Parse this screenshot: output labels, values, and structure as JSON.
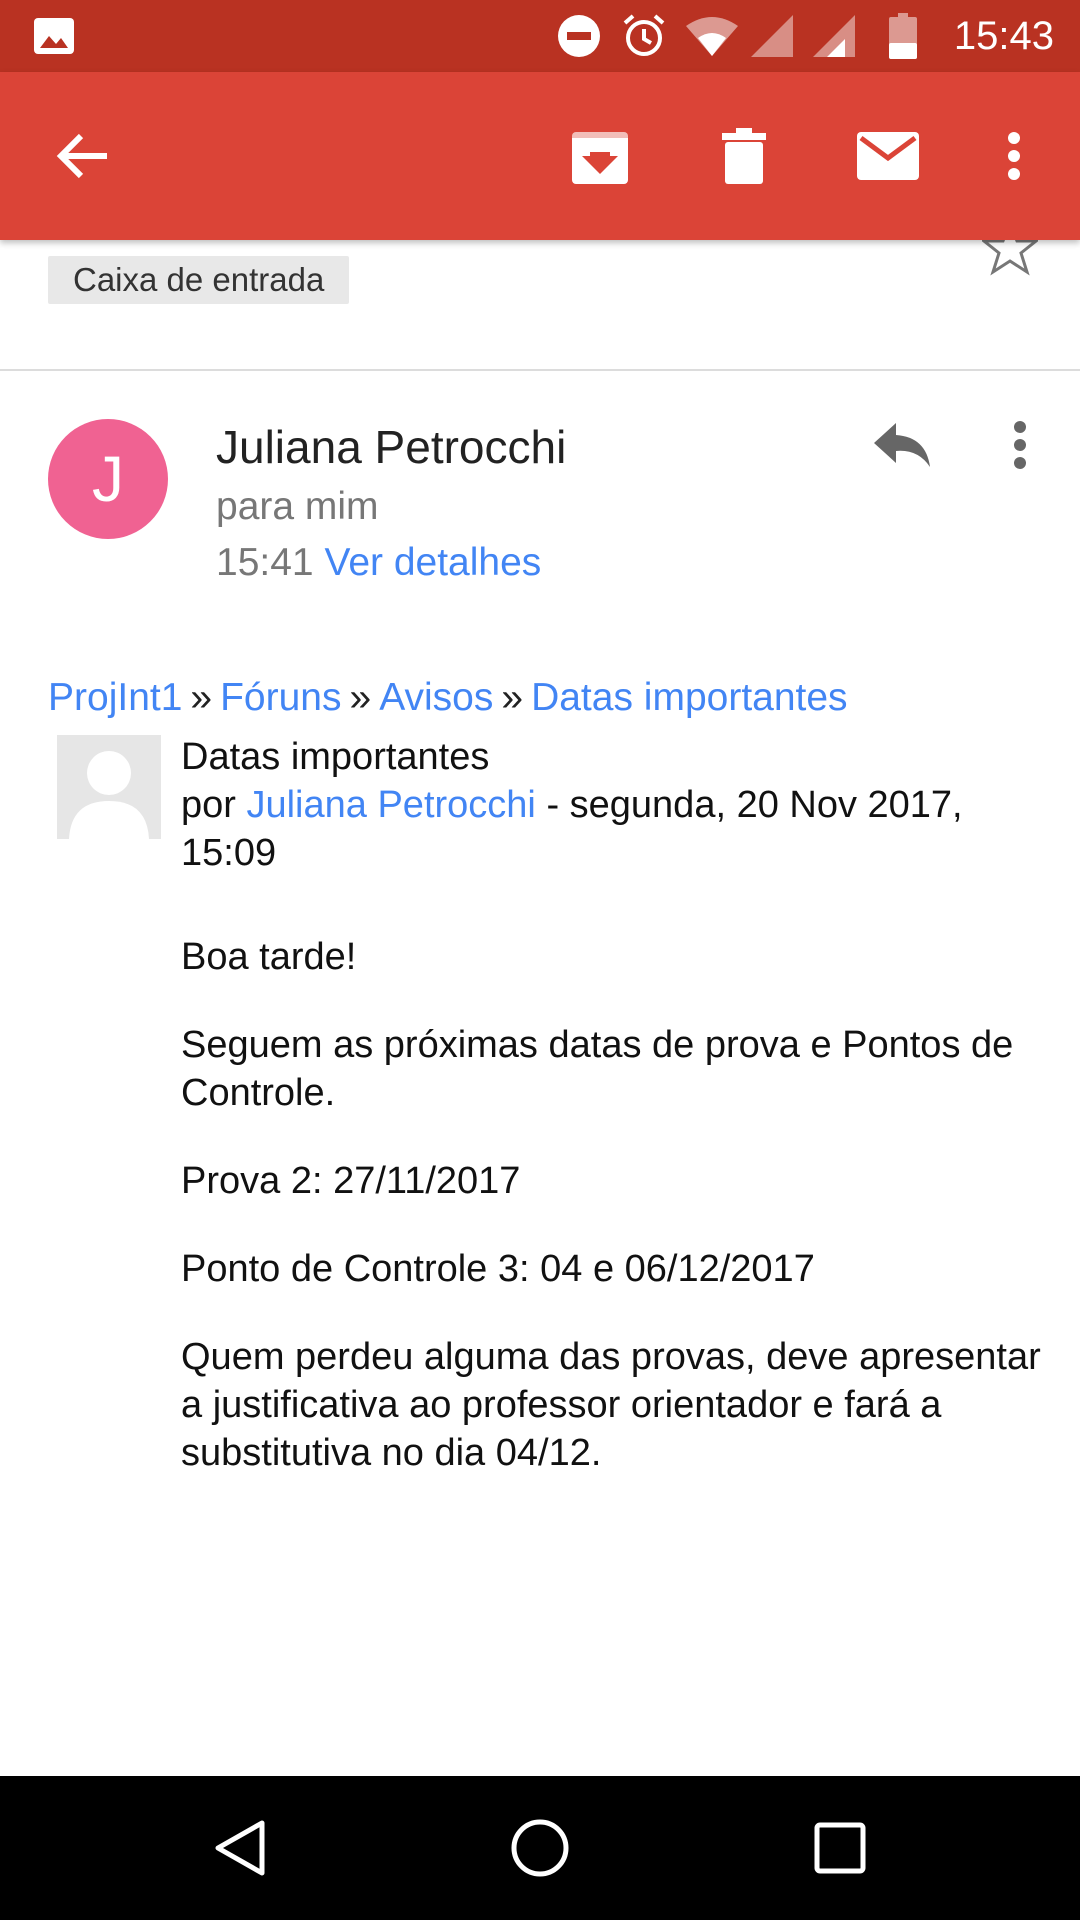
{
  "status_bar": {
    "time": "15:43",
    "icons": [
      "image-icon",
      "do-not-disturb-icon",
      "alarm-icon",
      "wifi-icon",
      "signal-icon",
      "signal-icon",
      "battery-icon"
    ]
  },
  "toolbar": {
    "actions": [
      "back-arrow-icon",
      "archive-icon",
      "delete-icon",
      "mark-unread-icon",
      "more-vert-icon"
    ]
  },
  "label": "Caixa de entrada",
  "sender": {
    "initial": "J",
    "name": "Juliana Petrocchi",
    "recipient": "para mim",
    "time": "15:41",
    "details_link": "Ver detalhes",
    "avatar_color": "#f06292"
  },
  "breadcrumb": {
    "items": [
      "ProjInt1",
      "Fóruns",
      "Avisos",
      "Datas importantes"
    ],
    "separator": "»"
  },
  "post": {
    "title": "Datas importantes",
    "by_prefix": "por",
    "author": "Juliana Petrocchi",
    "date": "- segunda, 20 Nov 2017, 15:09",
    "paragraphs": [
      "Boa tarde!",
      "Seguem as próximas datas de prova e Pontos de Controle.",
      "Prova 2: 27/11/2017",
      "Ponto de Controle 3: 04 e 06/12/2017",
      "Quem perdeu alguma das provas, deve apresentar a justificativa ao professor orientador e fará a substitutiva no dia 04/12."
    ]
  },
  "colors": {
    "status_bar": "#b93222",
    "toolbar": "#db4437",
    "link": "#4285f4"
  }
}
